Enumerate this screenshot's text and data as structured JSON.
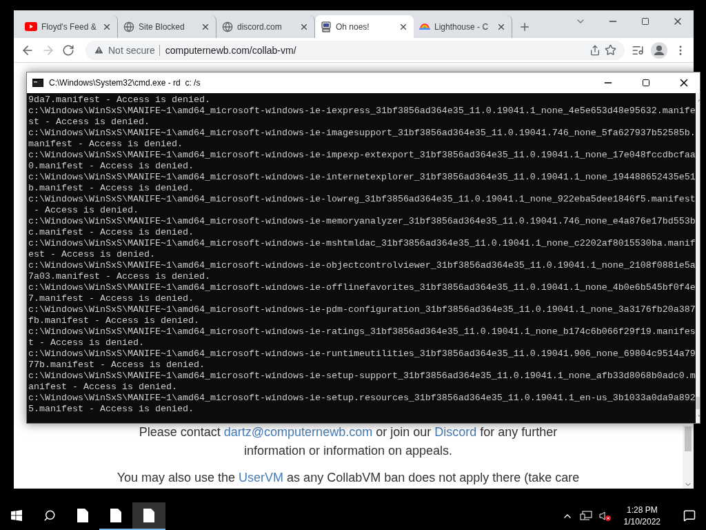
{
  "browser": {
    "tabs": [
      {
        "title": "Floyd's Feed &",
        "selected": false
      },
      {
        "title": "Site Blocked",
        "selected": false
      },
      {
        "title": "discord.com",
        "selected": false
      },
      {
        "title": "Oh noes!",
        "selected": true
      },
      {
        "title": "Lighthouse - C",
        "selected": false
      }
    ],
    "forward_disabled": true,
    "address": {
      "security": "Not secure",
      "url": "computernewb.com/collab-vm/"
    },
    "page": {
      "paragraphs": [
        {
          "lines": [
            [
              {
                "text": "Please contact ",
                "kind": "text"
              },
              {
                "text": "dartz@computernewb.com",
                "kind": "link"
              },
              {
                "text": " or join our ",
                "kind": "text"
              },
              {
                "text": "Discord",
                "kind": "link"
              },
              {
                "text": " for any further",
                "kind": "text"
              }
            ],
            [
              {
                "text": "information or information on appeals.",
                "kind": "text"
              }
            ]
          ]
        },
        {
          "lines": [
            [
              {
                "text": "You may also use the ",
                "kind": "text"
              },
              {
                "text": "UserVM",
                "kind": "link"
              },
              {
                "text": " as any CollabVM ban does not apply there (take care",
                "kind": "text"
              }
            ]
          ]
        }
      ]
    }
  },
  "console": {
    "title": "C:\\Windows\\System32\\cmd.exe - rd  c: /s",
    "lines": [
      "9da7.manifest - Access is denied.",
      "c:\\Windows\\WinSxS\\MANIFE~1\\amd64_microsoft-windows-ie-iexpress_31bf3856ad364e35_11.0.19041.1_none_4e5e653d48e95632.manife",
      "st - Access is denied.",
      "c:\\Windows\\WinSxS\\MANIFE~1\\amd64_microsoft-windows-ie-imagesupport_31bf3856ad364e35_11.0.19041.746_none_5fa627937b52585b.",
      "manifest - Access is denied.",
      "c:\\Windows\\WinSxS\\MANIFE~1\\amd64_microsoft-windows-ie-impexp-extexport_31bf3856ad364e35_11.0.19041.1_none_17e048fccdbcfaa",
      "0.manifest - Access is denied.",
      "c:\\Windows\\WinSxS\\MANIFE~1\\amd64_microsoft-windows-ie-internetexplorer_31bf3856ad364e35_11.0.19041.1_none_194488652435e51",
      "b.manifest - Access is denied.",
      "c:\\Windows\\WinSxS\\MANIFE~1\\amd64_microsoft-windows-ie-lowreg_31bf3856ad364e35_11.0.19041.1_none_922eba5dee1846f5.manifest",
      " - Access is denied.",
      "c:\\Windows\\WinSxS\\MANIFE~1\\amd64_microsoft-windows-ie-memoryanalyzer_31bf3856ad364e35_11.0.19041.746_none_e4a876e17bd553b",
      "c.manifest - Access is denied.",
      "c:\\Windows\\WinSxS\\MANIFE~1\\amd64_microsoft-windows-ie-mshtmldac_31bf3856ad364e35_11.0.19041.1_none_c2202af8015530ba.manif",
      "est - Access is denied.",
      "c:\\Windows\\WinSxS\\MANIFE~1\\amd64_microsoft-windows-ie-objectcontrolviewer_31bf3856ad364e35_11.0.19041.1_none_2108f0881e5a",
      "7a03.manifest - Access is denied.",
      "c:\\Windows\\WinSxS\\MANIFE~1\\amd64_microsoft-windows-ie-offlinefavorites_31bf3856ad364e35_11.0.19041.1_none_4b0e6b545bf0f4e",
      "7.manifest - Access is denied.",
      "c:\\Windows\\WinSxS\\MANIFE~1\\amd64_microsoft-windows-ie-pdm-configuration_31bf3856ad364e35_11.0.19041.1_none_3a3176fb20a387",
      "fb.manifest - Access is denied.",
      "c:\\Windows\\WinSxS\\MANIFE~1\\amd64_microsoft-windows-ie-ratings_31bf3856ad364e35_11.0.19041.1_none_b174c6b066f29f19.manifes",
      "t - Access is denied.",
      "c:\\Windows\\WinSxS\\MANIFE~1\\amd64_microsoft-windows-ie-runtimeutilities_31bf3856ad364e35_11.0.19041.906_none_69804c9514a79",
      "77b.manifest - Access is denied.",
      "c:\\Windows\\WinSxS\\MANIFE~1\\amd64_microsoft-windows-ie-setup-support_31bf3856ad364e35_11.0.19041.1_none_afb33d8068b0adc0.m",
      "anifest - Access is denied.",
      "c:\\Windows\\WinSxS\\MANIFE~1\\amd64_microsoft-windows-ie-setup.resources_31bf3856ad364e35_11.0.19041.1_en-us_3b1033a0da9a892",
      "5.manifest - Access is denied."
    ]
  },
  "taskbar": {
    "apps": [
      {
        "running": false,
        "selected": false
      },
      {
        "running": true,
        "selected": false
      },
      {
        "running": true,
        "selected": true
      }
    ],
    "time": "1:28 PM",
    "date": "1/10/2022"
  }
}
